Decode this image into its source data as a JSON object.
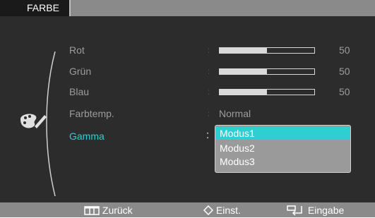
{
  "title": "FARBE",
  "menu": [
    {
      "label": "Rot",
      "type": "slider",
      "value": 50,
      "display": "50"
    },
    {
      "label": "Grün",
      "type": "slider",
      "value": 50,
      "display": "50"
    },
    {
      "label": "Blau",
      "type": "slider",
      "value": 50,
      "display": "50"
    },
    {
      "label": "Farbtemp.",
      "type": "text",
      "display": "Normal"
    },
    {
      "label": "Gamma",
      "type": "dropdown",
      "active": true
    }
  ],
  "separator": ":",
  "gamma_options": [
    "Modus1",
    "Modus2",
    "Modus3"
  ],
  "gamma_selected": "Modus1",
  "footer": {
    "back_label": "Zurück",
    "adjust_label": "Einst.",
    "enter_label": "Eingabe"
  },
  "icons": {
    "mode": "color-palette-icon",
    "back": "menu-grid-icon",
    "adjust": "up-down-diamond-icon",
    "enter": "enter-return-icon"
  },
  "colors": {
    "accent": "#2ecfd2",
    "background": "#2c2c2c",
    "bars": "#8a8a8a",
    "inactive_text": "#9c9c9c"
  }
}
